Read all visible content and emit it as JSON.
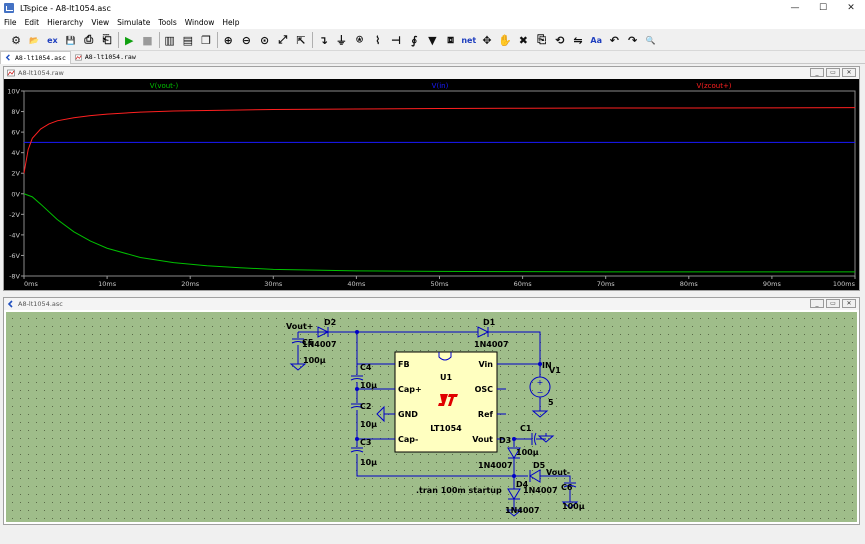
{
  "window": {
    "title": "LTspice - A8-lt1054.asc",
    "min": "—",
    "max": "☐",
    "close": "✕"
  },
  "menu": [
    "File",
    "Edit",
    "Hierarchy",
    "View",
    "Simulate",
    "Tools",
    "Window",
    "Help"
  ],
  "toolbar": {
    "tools": [
      {
        "name": "control-panel-icon",
        "glyph": "⚙"
      },
      {
        "name": "open-icon",
        "glyph": "📂"
      },
      {
        "name": "open-ex-icon",
        "glyph": "ex"
      },
      {
        "name": "save-icon",
        "glyph": "💾"
      },
      {
        "name": "print-icon",
        "glyph": "⎙"
      },
      {
        "name": "print-setup-icon",
        "glyph": "⎗"
      },
      {
        "name": "run-icon",
        "glyph": "▶"
      },
      {
        "name": "halt-icon",
        "glyph": "■"
      },
      {
        "name": "tile-vertical-icon",
        "glyph": "▥"
      },
      {
        "name": "tile-horizontal-icon",
        "glyph": "▤"
      },
      {
        "name": "cascade-icon",
        "glyph": "❐"
      },
      {
        "name": "zoom-in-icon",
        "glyph": "⊕"
      },
      {
        "name": "zoom-out-icon",
        "glyph": "⊖"
      },
      {
        "name": "zoom-fit-icon",
        "glyph": "⊙"
      },
      {
        "name": "zoom-back-icon",
        "glyph": "⤢"
      },
      {
        "name": "autorange-icon",
        "glyph": "⇱"
      },
      {
        "name": "wire-icon",
        "glyph": "↴"
      },
      {
        "name": "ground-icon",
        "glyph": "⏚"
      },
      {
        "name": "label-icon",
        "glyph": "⍟"
      },
      {
        "name": "resistor-icon",
        "glyph": "⌇"
      },
      {
        "name": "capacitor-icon",
        "glyph": "⊣"
      },
      {
        "name": "inductor-icon",
        "glyph": "∮"
      },
      {
        "name": "diode-icon",
        "glyph": "▼"
      },
      {
        "name": "component-icon",
        "glyph": "⧈"
      },
      {
        "name": "net-label-icon",
        "glyph": "net"
      },
      {
        "name": "move-icon",
        "glyph": "✥"
      },
      {
        "name": "drag-icon",
        "glyph": "✋"
      },
      {
        "name": "delete-icon",
        "glyph": "✖"
      },
      {
        "name": "duplicate-icon",
        "glyph": "⎘"
      },
      {
        "name": "rotate-icon",
        "glyph": "⟲"
      },
      {
        "name": "mirror-icon",
        "glyph": "⇋"
      },
      {
        "name": "text-icon",
        "glyph": "Aa"
      },
      {
        "name": "undo-icon",
        "glyph": "↶"
      },
      {
        "name": "redo-icon",
        "glyph": "↷"
      },
      {
        "name": "find-icon",
        "glyph": "🔍"
      }
    ]
  },
  "tabs": [
    {
      "label": "A8-lt1054.asc"
    },
    {
      "label": "A8-lt1054.raw"
    }
  ],
  "waveform_window": {
    "title": "A8-lt1054.raw",
    "traces": [
      {
        "name": "V(vout-)",
        "color": "#00c000"
      },
      {
        "name": "V(in)",
        "color": "#1a1aff"
      },
      {
        "name": "V(zcout+)",
        "color": "#ff2020"
      }
    ]
  },
  "chart_data": {
    "type": "line",
    "ylim": [
      -8,
      10
    ],
    "xlim": [
      0,
      100
    ],
    "y_ticks": [
      "10V",
      "8V",
      "6V",
      "4V",
      "2V",
      "0V",
      "-2V",
      "-4V",
      "-6V",
      "-8V"
    ],
    "x_ticks": [
      "0ms",
      "10ms",
      "20ms",
      "30ms",
      "40ms",
      "50ms",
      "60ms",
      "70ms",
      "80ms",
      "90ms",
      "100ms"
    ],
    "grid": false,
    "series": [
      {
        "name": "V(vout-)",
        "color": "#00c000",
        "x": [
          0,
          1,
          2,
          4,
          6,
          8,
          10,
          14,
          18,
          22,
          26,
          30,
          40,
          50,
          60,
          70,
          80,
          90,
          100
        ],
        "y": [
          0,
          -0.3,
          -1.0,
          -2.5,
          -3.7,
          -4.6,
          -5.3,
          -6.2,
          -6.7,
          -7.0,
          -7.2,
          -7.35,
          -7.5,
          -7.55,
          -7.58,
          -7.6,
          -7.6,
          -7.6,
          -7.6
        ]
      },
      {
        "name": "V(in)",
        "color": "#1a1aff",
        "x": [
          0,
          100
        ],
        "y": [
          5,
          5
        ]
      },
      {
        "name": "V(zcout+)",
        "color": "#ff2020",
        "x": [
          0,
          0.5,
          1,
          2,
          3,
          4,
          6,
          8,
          10,
          14,
          18,
          22,
          26,
          30,
          40,
          50,
          60,
          70,
          80,
          90,
          100
        ],
        "y": [
          2,
          4.3,
          5.4,
          6.3,
          6.8,
          7.1,
          7.4,
          7.6,
          7.75,
          7.95,
          8.05,
          8.1,
          8.15,
          8.2,
          8.25,
          8.3,
          8.32,
          8.34,
          8.35,
          8.36,
          8.38
        ]
      }
    ]
  },
  "schematic_window": {
    "title": "A8-lt1054.asc",
    "ic": {
      "ref": "U1",
      "part": "LT1054",
      "logo": "LT",
      "pins_left": [
        "FB",
        "Cap+",
        "GND",
        "Cap-"
      ],
      "pins_right": [
        "Vin",
        "OSC",
        "Ref",
        "Vout"
      ]
    },
    "labels": {
      "vout_plus": "Vout+",
      "vout_minus": "Vout-",
      "in": "IN",
      "c5": "C5",
      "c5_val": "100µ",
      "c4": "C4",
      "c4_val": "10µ",
      "c2": "C2",
      "c2_val": "10µ",
      "c3": "C3",
      "c3_val": "10µ",
      "c1": "C1",
      "c1_val": "100µ",
      "c6": "C6",
      "c6_val": "100µ",
      "d1": "D1",
      "d1_val": "1N4007",
      "d2": "D2",
      "d2_val": "1N4007",
      "d3": "D3",
      "d3_val": "1N4007",
      "d4": "D4",
      "d4_val": "1N4007",
      "d5": "D5",
      "d5_val": "1N4007",
      "v1": "V1",
      "v1_val": "5",
      "directive": ".tran 100m startup"
    }
  }
}
